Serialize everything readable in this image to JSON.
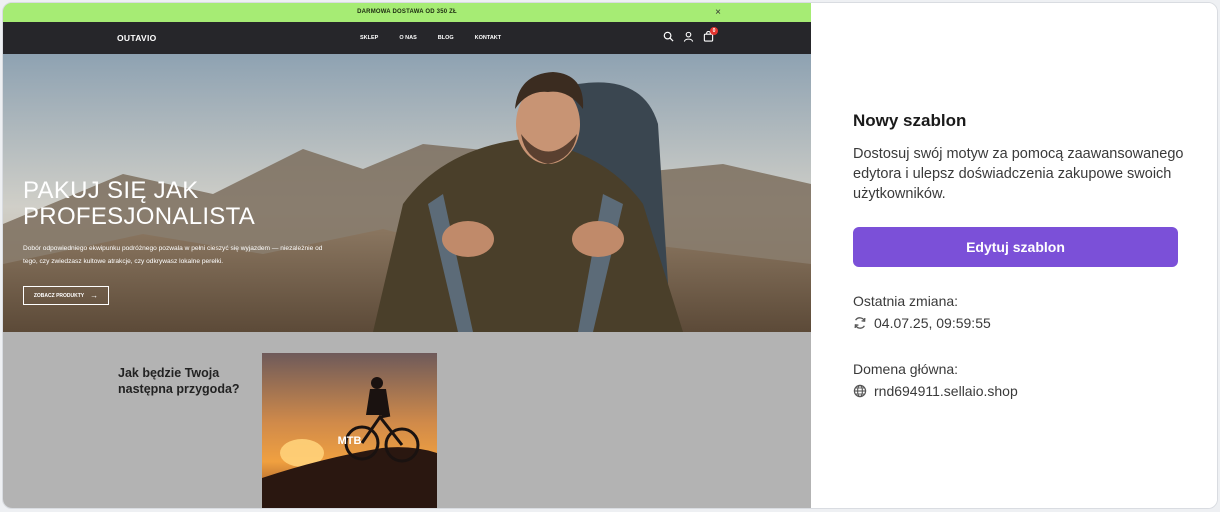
{
  "preview": {
    "promo_bar": {
      "text": "DARMOWA DOSTAWA OD 350 ZŁ",
      "close": "×"
    },
    "nav": {
      "logo": "OUTAVIO",
      "menu": [
        "SKLEP",
        "O NAS",
        "BLOG",
        "KONTAKT"
      ],
      "cart_count": "0",
      "icons": [
        "search-icon",
        "user-icon",
        "cart-icon"
      ]
    },
    "hero": {
      "title": "PAKUJ SIĘ JAK PROFESJONALISTA",
      "subtitle": "Dobór odpowiedniego ekwipunku podróżnego pozwala w pełni cieszyć się wyjazdem — niezależnie od tego, czy zwiedzasz kultowe atrakcje, czy odkrywasz lokalne perełki.",
      "button": "ZOBACZ PRODUKTY"
    },
    "section": {
      "title": "Jak będzie Twoja następna przygoda?",
      "tile_label": "MTB"
    },
    "colors": {
      "promo": "#a6ec74",
      "nav": "#26262a"
    }
  },
  "panel": {
    "title": "Nowy szablon",
    "description": "Dostosuj swój motyw za pomocą zaawansowanego edytora i ulepsz doświadczenia zakupowe swoich użytkowników.",
    "edit_button": "Edytuj szablon",
    "last_change_label": "Ostatnia zmiana:",
    "last_change_value": "04.07.25, 09:59:55",
    "domain_label": "Domena główna:",
    "domain_value": "rnd694911.sellaio.shop",
    "icons": [
      "refresh-icon",
      "globe-icon"
    ],
    "accent_color": "#7b50d8"
  }
}
